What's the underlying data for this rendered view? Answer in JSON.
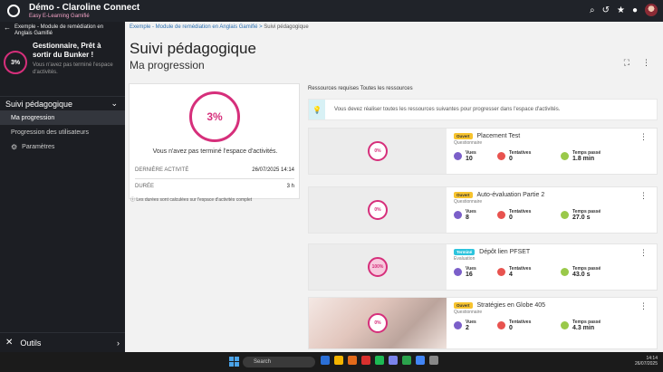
{
  "app": {
    "title": "Démo - Claroline Connect",
    "subtitle": "Easy E-Learning Gamifié"
  },
  "sidebar": {
    "course_title": "Exemple - Module de remédiation en Anglais Gamifié",
    "progress_badge": "3%",
    "card_title": "Gestionnaire, Prêt à sortir du Bunker !",
    "card_subtitle": "Vous n'avez pas terminé l'espace d'activités.",
    "section_label": "Suivi pédagogique",
    "items": [
      {
        "label": "Ma progression"
      },
      {
        "label": "Progression des utilisateurs"
      },
      {
        "label": "Paramètres"
      }
    ],
    "tools_label": "Outils"
  },
  "breadcrumb": {
    "link": "Exemple - Module de remédiation en Anglais Gamifié",
    "separator": ">",
    "current": "Suivi pédagogique"
  },
  "page": {
    "title": "Suivi pédagogique",
    "subtitle": "Ma progression"
  },
  "progress": {
    "percent": "3%",
    "percent_value": 0.03,
    "message": "Vous n'avez pas terminé l'espace d'activités.",
    "row1_label": "DERNIÈRE ACTIVITÉ",
    "row1_value": "26/07/2025 14:14",
    "row2_label": "DURÉE",
    "row2_value": "3 h",
    "note": "Les durées sont calculées sur l'espace d'activités complet"
  },
  "resources_header": "Ressources requises   Toutes les ressources",
  "tip": {
    "text": "Vous devez réaliser toutes les ressources suivantes pour progresser dans l'espace d'activités."
  },
  "stat_labels": {
    "views": "Vues",
    "tries": "Tentatives",
    "time": "Temps passé"
  },
  "resources": [
    {
      "status": "Ouvert",
      "name": "Placement Test",
      "kind": "Questionnaire",
      "progress": "0%",
      "views": "10",
      "tries": "0",
      "time": "1.8 min"
    },
    {
      "status": "Ouvert",
      "name": "Auto-évaluation Partie 2",
      "kind": "Questionnaire",
      "progress": "0%",
      "views": "8",
      "tries": "0",
      "time": "27.0 s"
    },
    {
      "status": "Terminé",
      "name": "Dépôt lien PFSET",
      "kind": "Evaluation",
      "progress": "100%",
      "views": "16",
      "tries": "4",
      "time": "43.0 s"
    },
    {
      "status": "Ouvert",
      "name": "Stratégies en Globe 405",
      "kind": "Questionnaire",
      "progress": "0%",
      "views": "2",
      "tries": "0",
      "time": "4.3 min"
    }
  ],
  "taskbar": {
    "search_placeholder": "Search",
    "time": "14:14",
    "date": "26/07/2025"
  }
}
